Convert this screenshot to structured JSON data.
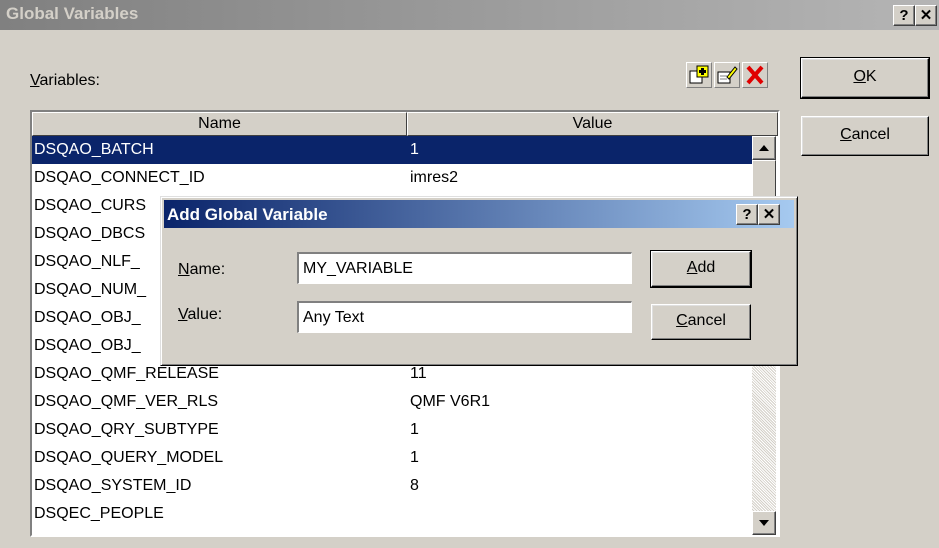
{
  "window": {
    "title": "Global Variables",
    "help_glyph": "?",
    "close_glyph": "✕"
  },
  "variables_label": {
    "prefix": "",
    "accel": "V",
    "rest": "ariables:"
  },
  "toolbar": {
    "add_icon": "add-variable-icon",
    "edit_icon": "edit-variable-icon",
    "delete_icon": "delete-variable-icon"
  },
  "buttons": {
    "ok": {
      "accel": "O",
      "rest": "K"
    },
    "cancel": {
      "accel": "C",
      "rest": "ancel"
    }
  },
  "table": {
    "columns": [
      "Name",
      "Value"
    ],
    "rows": [
      {
        "name": "DSQAO_BATCH",
        "value": "1"
      },
      {
        "name": "DSQAO_CONNECT_ID",
        "value": "imres2"
      },
      {
        "name": "DSQAO_CURS",
        "value": ""
      },
      {
        "name": "DSQAO_DBCS",
        "value": ""
      },
      {
        "name": "DSQAO_NLF_",
        "value": ""
      },
      {
        "name": "DSQAO_NUM_",
        "value": ""
      },
      {
        "name": "DSQAO_OBJ_",
        "value": ""
      },
      {
        "name": "DSQAO_OBJ_",
        "value": ""
      },
      {
        "name": "DSQAO_QMF_RELEASE",
        "value": "11"
      },
      {
        "name": "DSQAO_QMF_VER_RLS",
        "value": "QMF V6R1"
      },
      {
        "name": "DSQAO_QRY_SUBTYPE",
        "value": "1"
      },
      {
        "name": "DSQAO_QUERY_MODEL",
        "value": "1"
      },
      {
        "name": "DSQAO_SYSTEM_ID",
        "value": "8"
      },
      {
        "name": "DSQEC_PEOPLE",
        "value": ""
      }
    ],
    "selected_index": 0
  },
  "dialog": {
    "title": "Add Global Variable",
    "help_glyph": "?",
    "close_glyph": "✕",
    "name_label": {
      "accel": "N",
      "rest": "ame:"
    },
    "value_label": {
      "accel": "V",
      "rest": "alue:"
    },
    "name_value": "MY_VARIABLE",
    "value_value": "Any Text",
    "add_button": {
      "accel": "A",
      "rest": "dd"
    },
    "cancel_button": {
      "accel": "C",
      "rest": "ancel"
    }
  },
  "colors": {
    "selection": "#0a246a",
    "face": "#d4d0c8",
    "inactive_title": "#808080",
    "active_title": "#0a246a",
    "delete_red": "#e00000"
  }
}
